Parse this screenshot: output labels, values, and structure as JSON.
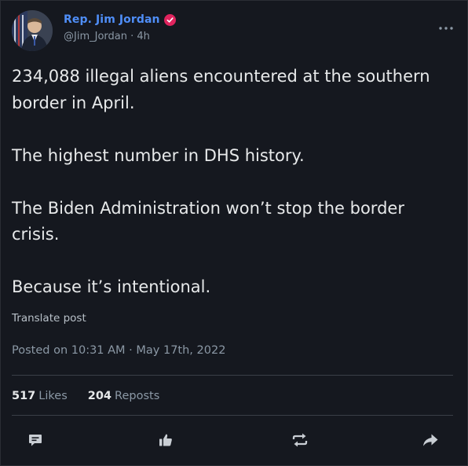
{
  "author": {
    "display_name": "Rep. Jim Jordan",
    "handle_line": "@Jim_Jordan · 4h",
    "verified_color": "#e0245e"
  },
  "post": {
    "line1": "234,088 illegal aliens encountered at the southern",
    "line2": "border in April.",
    "line3": "The highest number in DHS history.",
    "line4": "The Biden Administration won’t stop the border",
    "line5": "crisis.",
    "line6": "Because it’s intentional."
  },
  "translate_label": "Translate post",
  "posted_label": "Posted on 10:31 AM · May 17th, 2022",
  "stats": {
    "likes_count": "517",
    "likes_label": "Likes",
    "reposts_count": "204",
    "reposts_label": "Reposts"
  },
  "icons": {
    "more": "more-dots-icon",
    "reply": "comment-icon",
    "like": "thumbs-up-icon",
    "repost": "repost-icon",
    "share": "share-arrow-icon"
  },
  "colors": {
    "background": "#15181f",
    "name": "#4f8ef7",
    "text": "#e7e9ea",
    "muted": "#8b98a5"
  }
}
